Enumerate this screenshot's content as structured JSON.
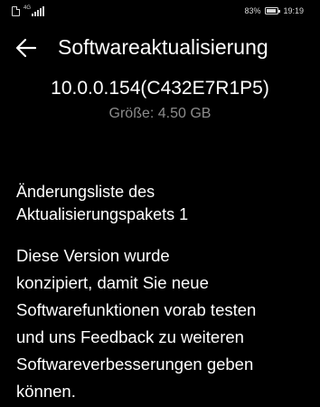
{
  "status_bar": {
    "network_type": "4G",
    "battery_percent": "83%",
    "battery_level": 0.83,
    "time": "19:19",
    "icons": [
      "sim-card-icon",
      "signal-bars-icon",
      "battery-icon"
    ]
  },
  "app_bar": {
    "back_icon": "arrow-left-icon",
    "title": "Softwareaktualisierung"
  },
  "update": {
    "version": "10.0.0.154(C432E7R1P5)",
    "size_text": "Größe: 4.50 GB"
  },
  "changelog": {
    "heading_lines": [
      "Änderungsliste des",
      "Aktualisierungspakets 1"
    ],
    "body_lines": [
      "Diese Version wurde",
      "konzipiert, damit Sie neue",
      "Softwarefunktionen vorab testen",
      "und uns Feedback zu weiteren",
      "Softwareverbesserungen geben",
      "können."
    ]
  },
  "colors": {
    "background": "#000000",
    "text_primary": "#ffffff",
    "text_secondary": "#8c8c8c"
  }
}
